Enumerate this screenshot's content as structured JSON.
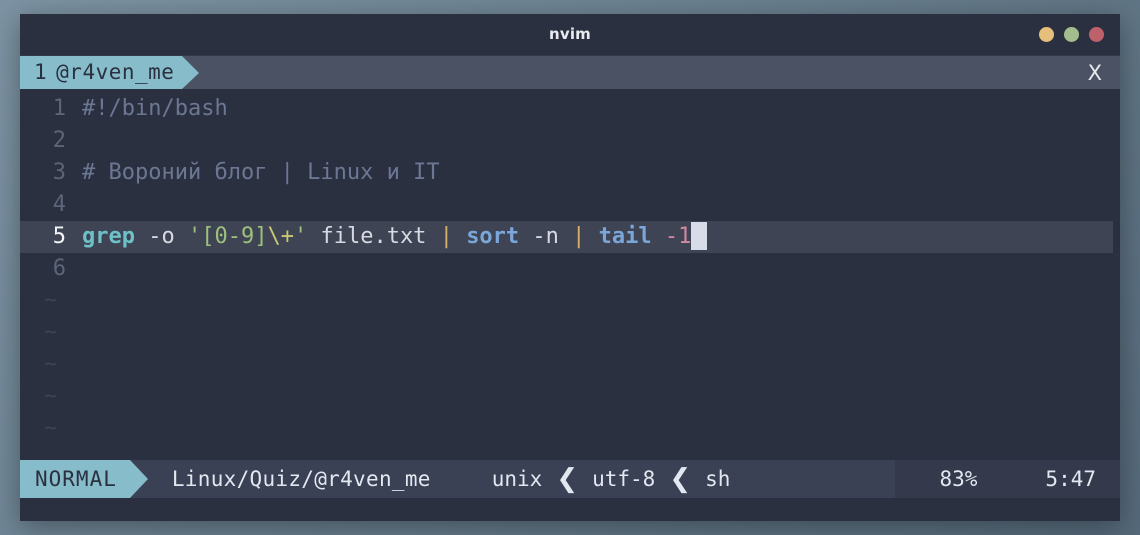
{
  "window": {
    "title": "nvim",
    "controls": [
      {
        "name": "minimize",
        "color": "#e6c07b"
      },
      {
        "name": "maximize",
        "color": "#a3be8c"
      },
      {
        "name": "close",
        "color": "#bf616a"
      }
    ]
  },
  "tabline": {
    "buffer_number": "1",
    "buffer_name": "@r4ven_me",
    "close_label": "X"
  },
  "editor": {
    "lines": [
      {
        "num": "1",
        "text": "#!/bin/bash"
      },
      {
        "num": "2",
        "text": ""
      },
      {
        "num": "3",
        "text": "# Вороний блог | Linux и IT"
      },
      {
        "num": "4",
        "text": ""
      },
      {
        "num": "5",
        "text": "grep -o '[0-9]\\+' file.txt | sort -n | tail -1"
      },
      {
        "num": "6",
        "text": ""
      }
    ],
    "current_line": "5",
    "current_line_tokens": [
      {
        "t": "grep",
        "c": "t-cmd-a"
      },
      {
        "t": " ",
        "c": "t-plain"
      },
      {
        "t": "-o",
        "c": "t-plain"
      },
      {
        "t": " ",
        "c": "t-plain"
      },
      {
        "t": "'[0-9]",
        "c": "t-string"
      },
      {
        "t": "\\+",
        "c": "t-escape"
      },
      {
        "t": "'",
        "c": "t-string"
      },
      {
        "t": " ",
        "c": "t-plain"
      },
      {
        "t": "file.txt",
        "c": "t-plain"
      },
      {
        "t": " ",
        "c": "t-plain"
      },
      {
        "t": "|",
        "c": "t-pipe"
      },
      {
        "t": " ",
        "c": "t-plain"
      },
      {
        "t": "sort",
        "c": "t-cmd-b"
      },
      {
        "t": " ",
        "c": "t-plain"
      },
      {
        "t": "-n",
        "c": "t-plain"
      },
      {
        "t": " ",
        "c": "t-plain"
      },
      {
        "t": "|",
        "c": "t-pipe"
      },
      {
        "t": " ",
        "c": "t-plain"
      },
      {
        "t": "tail",
        "c": "t-cmd-b"
      },
      {
        "t": " ",
        "c": "t-plain"
      },
      {
        "t": "-1",
        "c": "t-num"
      }
    ],
    "empty_markers": [
      "~",
      "~",
      "~",
      "~",
      "~"
    ]
  },
  "statusline": {
    "mode": "NORMAL",
    "path": "Linux/Quiz/@r4ven_me",
    "fileformat": "unix",
    "encoding": "utf-8",
    "filetype": "sh",
    "percent": "83%",
    "position": "5:47",
    "separator": "❮"
  },
  "colors": {
    "accent": "#87bcca",
    "window_bg": "#2b3040",
    "tabline_bg": "#4b5263",
    "statusline_bg": "#3a4154",
    "current_line_bg": "#3e4453",
    "cursor": "#d8dce8"
  }
}
